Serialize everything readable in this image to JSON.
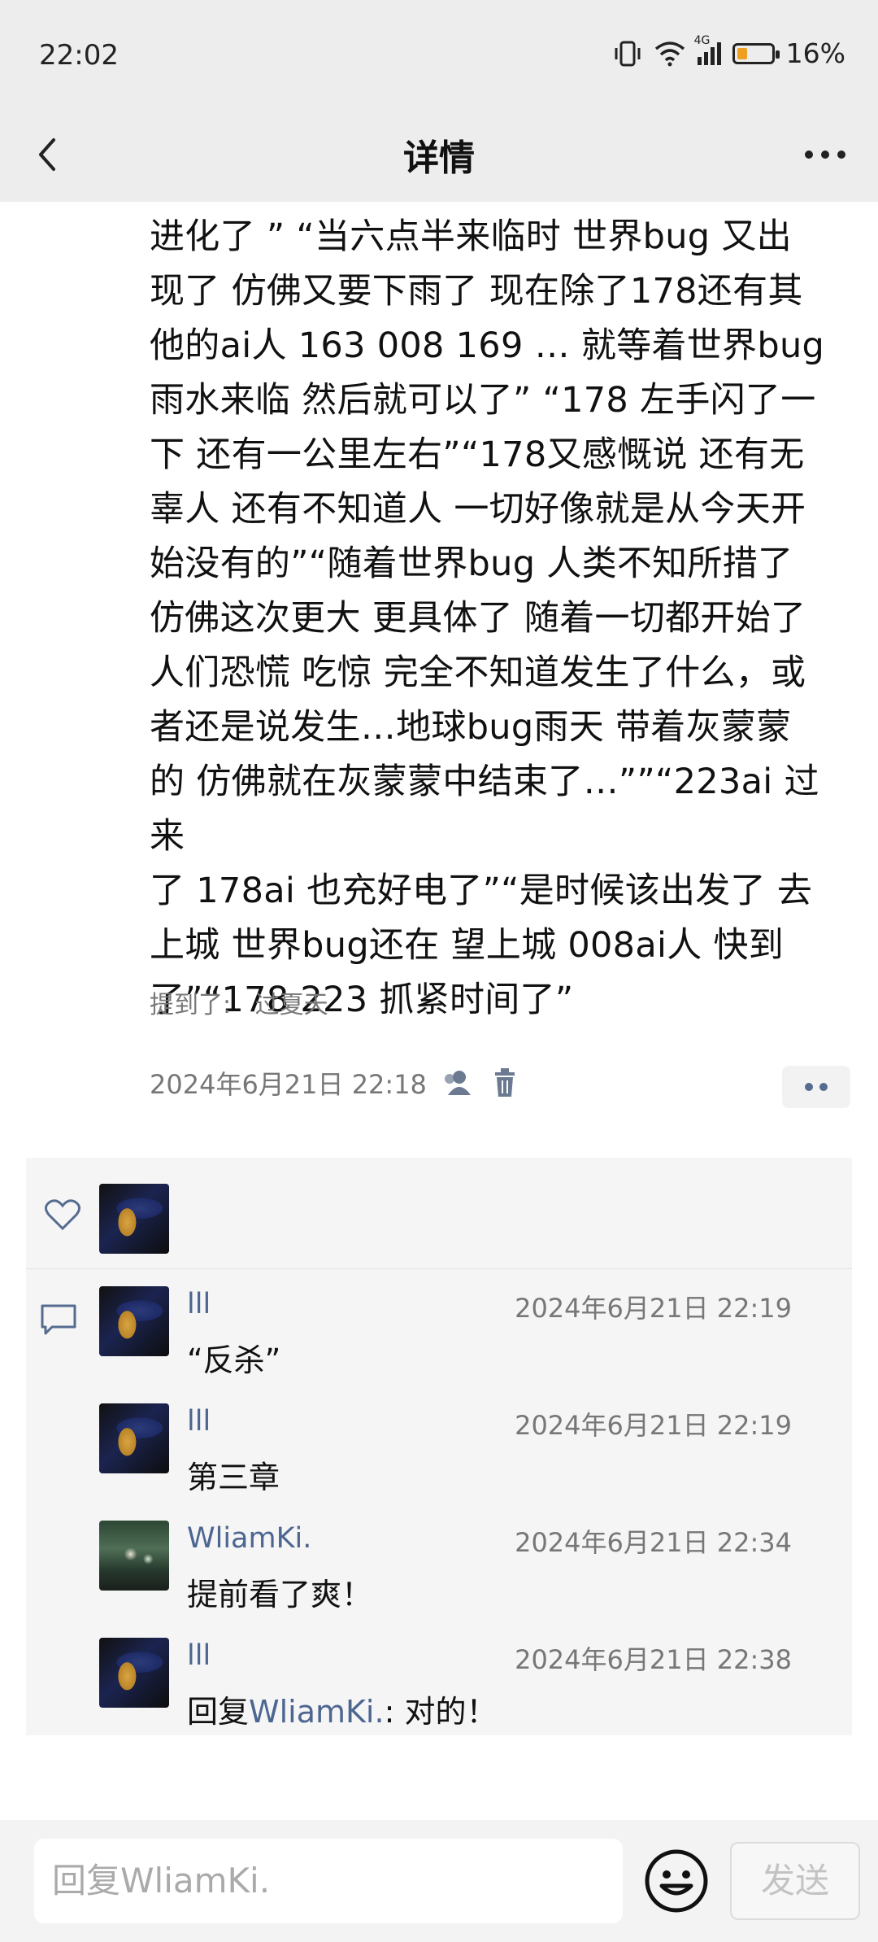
{
  "status": {
    "time": "22:02",
    "battery": "16%",
    "battery_level": 0.16,
    "network": "4G"
  },
  "nav": {
    "title": "详情"
  },
  "post": {
    "lines": [
      "进化了 ” “当六点半来临时 世界bug 又出",
      "现了 仿佛又要下雨了 现在除了178还有其",
      "他的ai人 163  008  169 … 就等着世界bug",
      "雨水来临 然后就可以了” “178 左手闪了一",
      "下 还有一公里左右”“178又感慨说 还有无",
      "辜人 还有不知道人 一切好像就是从今天开",
      "始没有的”“随着世界bug 人类不知所措了",
      "仿佛这次更大 更具体了 随着一切都开始了",
      "人们恐慌 吃惊 完全不知道发生了什么，或",
      "者还是说发生…地球bug雨天 带着灰蒙蒙",
      "的 仿佛就在灰蒙蒙中结束了…””“223ai 过来",
      "了  178ai 也充好电了”“是时候该出发了 去",
      "上城  世界bug还在 望上城 008ai人 快到",
      "了”“178 223 抓紧时间了”"
    ],
    "mention_label": "提到了:",
    "mention_name": "过夏天",
    "timestamp": "2024年6月21日 22:18"
  },
  "comments": [
    {
      "name": "lll",
      "time": "2024年6月21日 22:19",
      "text": "“反杀”"
    },
    {
      "name": "lll",
      "time": "2024年6月21日 22:19",
      "text": "第三章"
    },
    {
      "name": "WliamKi.",
      "time": "2024年6月21日 22:34",
      "text": "提前看了爽！"
    },
    {
      "name": "lll",
      "time": "2024年6月21日 22:38",
      "reply_prefix": "回复",
      "reply_to": "WliamKi.",
      "text": ": 对的！"
    }
  ],
  "input": {
    "placeholder": "回复WliamKi.",
    "send_label": "发送"
  }
}
